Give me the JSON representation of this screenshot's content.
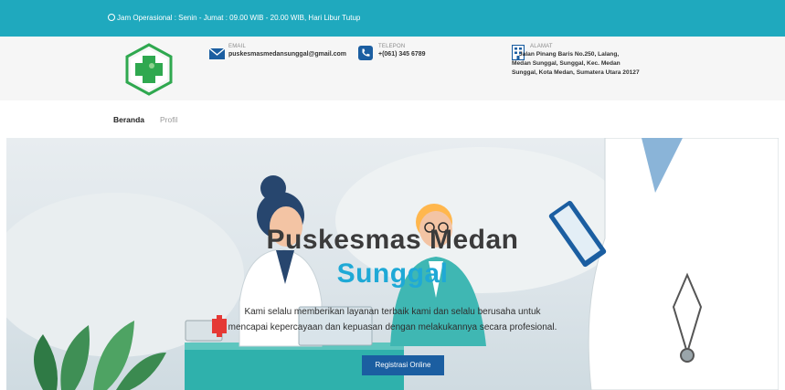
{
  "topbar": {
    "hours": "Jam Operasional : Senin - Jumat : 09.00 WIB - 20.00 WIB, Hari Libur Tutup"
  },
  "header": {
    "email": {
      "label": "EMAIL",
      "value": "puskesmasmedansunggal@gmail.com"
    },
    "phone": {
      "label": "TELEPON",
      "value": "+(061) 345 6789"
    },
    "address": {
      "label": "ALAMAT",
      "lines": [
        "Jalan Pinang Baris No.250, Lalang,",
        "Medan Sunggal, Sunggal, Kec. Medan",
        "Sunggal, Kota Medan, Sumatera Utara 20127"
      ]
    }
  },
  "nav": {
    "items": [
      "Beranda",
      "Profil"
    ]
  },
  "hero": {
    "title_line1": "Puskesmas Medan",
    "title_line2": "Sunggal",
    "desc_line1": "Kami selalu memberikan layanan terbaik kami dan selalu berusaha untuk",
    "desc_line2": "mencapai kepercayaan dan kepuasan dengan melakukannya secara profesional.",
    "button": "Registrasi Online"
  },
  "colors": {
    "topbar": "#1fa9be",
    "accent_blue": "#1fa9d6",
    "button": "#1b5ea1",
    "logo_green": "#2fa84f"
  }
}
